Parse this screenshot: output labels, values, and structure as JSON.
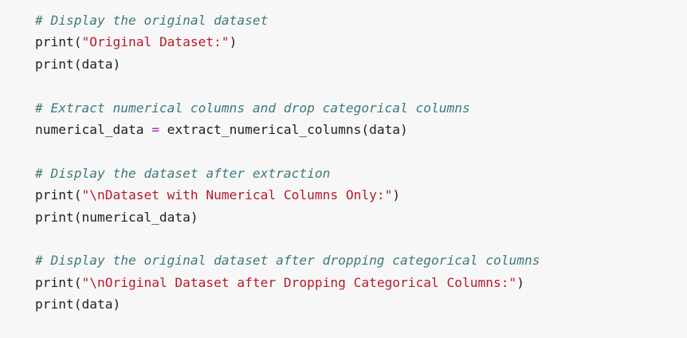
{
  "colors": {
    "background": "#f7f7f7",
    "text": "#1f1f1f",
    "comment": "#3f7a7a",
    "string": "#b31d28",
    "operator": "#a626a4"
  },
  "code": {
    "block1": {
      "comment": "# Display the original dataset",
      "line1_prefix": "print(",
      "line1_string": "\"Original Dataset:\"",
      "line1_suffix": ")",
      "line2": "print(data)"
    },
    "block2": {
      "comment": "# Extract numerical columns and drop categorical columns",
      "assign_left": "numerical_data ",
      "assign_op": "=",
      "assign_right": " extract_numerical_columns(data)"
    },
    "block3": {
      "comment": "# Display the dataset after extraction",
      "line1_prefix": "print(",
      "line1_string": "\"\\nDataset with Numerical Columns Only:\"",
      "line1_suffix": ")",
      "line2": "print(numerical_data)"
    },
    "block4": {
      "comment": "# Display the original dataset after dropping categorical columns",
      "line1_prefix": "print(",
      "line1_string": "\"\\nOriginal Dataset after Dropping Categorical Columns:\"",
      "line1_suffix": ")",
      "line2": "print(data)"
    }
  }
}
